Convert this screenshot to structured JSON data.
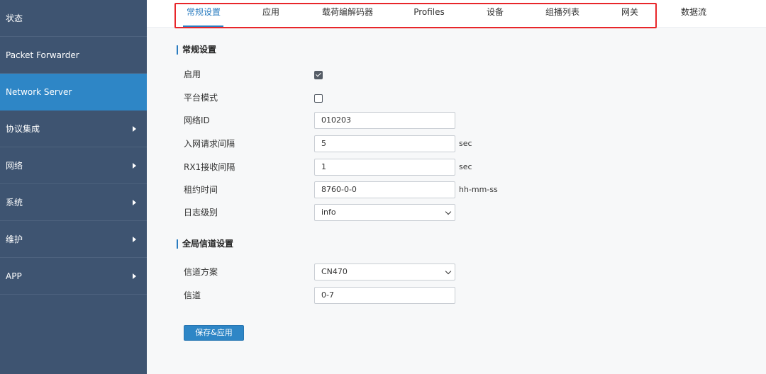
{
  "sidebar": {
    "items": [
      {
        "label": "状态"
      },
      {
        "label": "Packet Forwarder"
      },
      {
        "label": "Network Server"
      },
      {
        "label": "协议集成"
      },
      {
        "label": "网络"
      },
      {
        "label": "系统"
      },
      {
        "label": "维护"
      },
      {
        "label": "APP"
      }
    ]
  },
  "tabs": [
    {
      "label": "常规设置"
    },
    {
      "label": "应用"
    },
    {
      "label": "载荷编解码器"
    },
    {
      "label": "Profiles"
    },
    {
      "label": "设备"
    },
    {
      "label": "组播列表"
    },
    {
      "label": "网关"
    },
    {
      "label": "数据流"
    }
  ],
  "general": {
    "title": "常规设置",
    "enable_label": "启用",
    "enable_checked": true,
    "platform_mode_label": "平台模式",
    "platform_mode_checked": false,
    "network_id_label": "网络ID",
    "network_id_value": "010203",
    "join_interval_label": "入网请求间隔",
    "join_interval_value": "5",
    "join_interval_unit": "sec",
    "rx1_label": "RX1接收间隔",
    "rx1_value": "1",
    "rx1_unit": "sec",
    "lease_label": "租约时间",
    "lease_value": "8760-0-0",
    "lease_unit": "hh-mm-ss",
    "log_level_label": "日志级别",
    "log_level_value": "info"
  },
  "channel": {
    "title": "全局信道设置",
    "plan_label": "信道方案",
    "plan_value": "CN470",
    "channel_label": "信道",
    "channel_value": "0-7"
  },
  "actions": {
    "save_label": "保存&应用"
  },
  "colors": {
    "sidebar_bg": "#3e5471",
    "sidebar_active": "#2e86c6",
    "accent": "#2a7cc0",
    "highlight_box": "#e8262a"
  }
}
